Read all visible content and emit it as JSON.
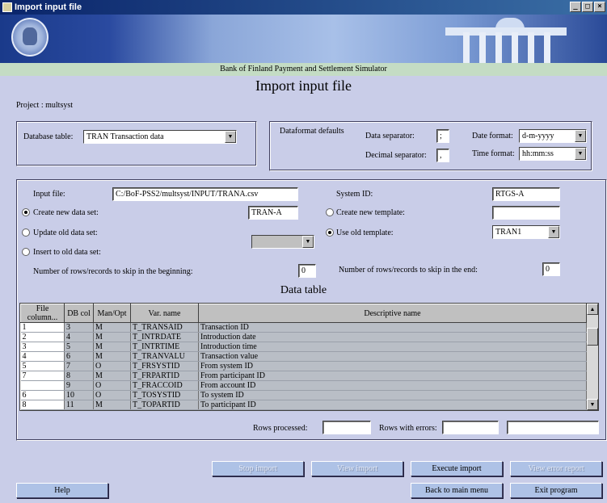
{
  "window": {
    "title": "Import input file",
    "controls": [
      "_",
      "□",
      "×"
    ]
  },
  "banner": {
    "subtitle": "Bank of Finland Payment and Settlement Simulator"
  },
  "page": {
    "title": "Import input file",
    "project_label": "Project : multsyst"
  },
  "database": {
    "label": "Database table:",
    "value": "TRAN Transaction data"
  },
  "dataformat": {
    "label": "Dataformat defaults",
    "data_sep_label": "Data separator:",
    "data_sep_value": ";",
    "dec_sep_label": "Decimal separator:",
    "dec_sep_value": ",",
    "date_label": "Date format:",
    "date_value": "d-m-yyyy",
    "time_label": "Time format:",
    "time_value": "hh:mm:ss"
  },
  "input": {
    "file_label": "Input file:",
    "file_value": "C:/BoF-PSS2/multsyst/INPUT/TRANA.csv",
    "system_label": "System ID:",
    "system_value": "RTGS-A",
    "create_new_label": "Create new data set:",
    "create_new_value": "TRAN-A",
    "create_template_label": "Create new template:",
    "create_template_value": "",
    "update_old_label": "Update old data set:",
    "use_template_label": "Use old template:",
    "use_template_value": "TRAN1",
    "insert_old_label": "Insert to old data set:",
    "skip_begin_label": "Number of rows/records to skip in the beginning:",
    "skip_begin_value": "0",
    "skip_end_label": "Number of rows/records to skip in the end:",
    "skip_end_value": "0"
  },
  "table": {
    "title": "Data table",
    "headers": [
      "File column...",
      "DB col",
      "Man/Opt",
      "Var. name",
      "Descriptive name"
    ],
    "rows": [
      [
        "1",
        "3",
        "M",
        "T_TRANSAID",
        "Transaction ID"
      ],
      [
        "2",
        "4",
        "M",
        "T_INTRDATE",
        "Introduction date"
      ],
      [
        "3",
        "5",
        "M",
        "T_INTRTIME",
        "Introduction time"
      ],
      [
        "4",
        "6",
        "M",
        "T_TRANVALU",
        "Transaction value"
      ],
      [
        "5",
        "7",
        "O",
        "T_FRSYSTID",
        "From system ID"
      ],
      [
        "7",
        "8",
        "M",
        "T_FRPARTID",
        "From participant ID"
      ],
      [
        "",
        "9",
        "O",
        "T_FRACCOID",
        "From account ID"
      ],
      [
        "6",
        "10",
        "O",
        "T_TOSYSTID",
        "To system ID"
      ],
      [
        "8",
        "11",
        "M",
        "T_TOPARTID",
        "To participant ID"
      ]
    ]
  },
  "status": {
    "rows_processed_label": "Rows processed:",
    "rows_processed_value": "",
    "rows_errors_label": "Rows with errors:",
    "rows_errors_value": "",
    "extra_value": ""
  },
  "buttons": {
    "stop": "Stop import",
    "view_import": "View import",
    "execute": "Execute import",
    "view_errors": "View error report",
    "help": "Help",
    "back": "Back to main menu",
    "exit": "Exit program"
  },
  "icons": {
    "radio": "radio-button",
    "arrow": "chevron-down-icon"
  }
}
